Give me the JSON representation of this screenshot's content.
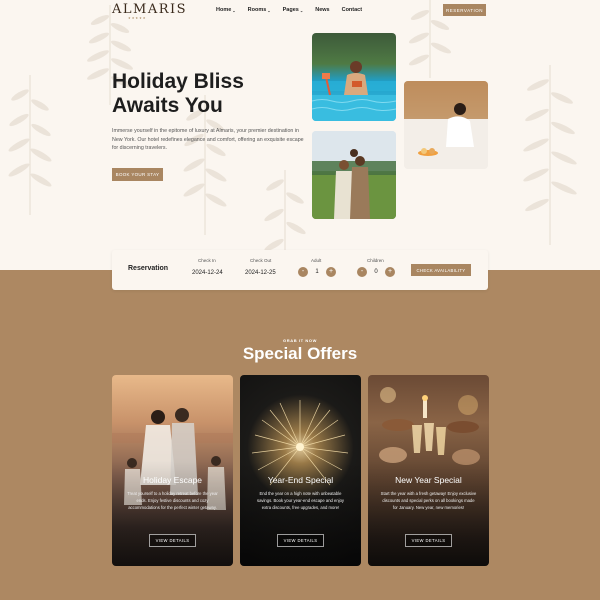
{
  "brand": {
    "name": "ALMARIS",
    "stars": "★★★★★"
  },
  "nav": {
    "items": [
      {
        "label": "Home",
        "dropdown": true
      },
      {
        "label": "Rooms",
        "dropdown": true
      },
      {
        "label": "Pages",
        "dropdown": true
      },
      {
        "label": "News",
        "dropdown": false
      },
      {
        "label": "Contact",
        "dropdown": false
      }
    ],
    "reservation_label": "RESERVATION"
  },
  "hero": {
    "title_line1": "Holiday Bliss",
    "title_line2": "Awaits You",
    "description": "Immerse yourself in the epitome of luxury at Almaris, your premier destination in New York. Our hotel redefines elegance and comfort, offering an exquisite escape for discerning travelers.",
    "button_label": "BOOK YOUR STAY"
  },
  "reservation": {
    "title": "Reservation",
    "check_in_label": "Check In",
    "check_in_value": "2024-12-24",
    "check_out_label": "Check Out",
    "check_out_value": "2024-12-25",
    "adult_label": "Adult",
    "adult_value": "1",
    "children_label": "Children",
    "children_value": "0",
    "minus": "-",
    "plus": "+",
    "button_label": "CHECK AVAILABILITY"
  },
  "offers": {
    "kicker": "GRAB IT NOW",
    "title": "Special Offers",
    "cards": [
      {
        "title": "Holiday Escape",
        "description": "Treat yourself to a holiday retreat before the year ends. Enjoy festive discounts and cozy accommodations for the perfect winter getaway.",
        "button_label": "VIEW DETAILS"
      },
      {
        "title": "Year-End Special",
        "description": "End the year on a high note with unbeatable savings. Book your year-end escape and enjoy extra discounts, free upgrades, and more!",
        "button_label": "VIEW DETAILS"
      },
      {
        "title": "New Year Special",
        "description": "Start the year with a fresh getaway! Enjoy exclusive discounts and special perks on all bookings made for January. New year, new memories!",
        "button_label": "VIEW DETAILS"
      }
    ]
  },
  "colors": {
    "accent": "#a98661",
    "section_background": "#ad8862",
    "hero_background": "#fbf6f0"
  }
}
